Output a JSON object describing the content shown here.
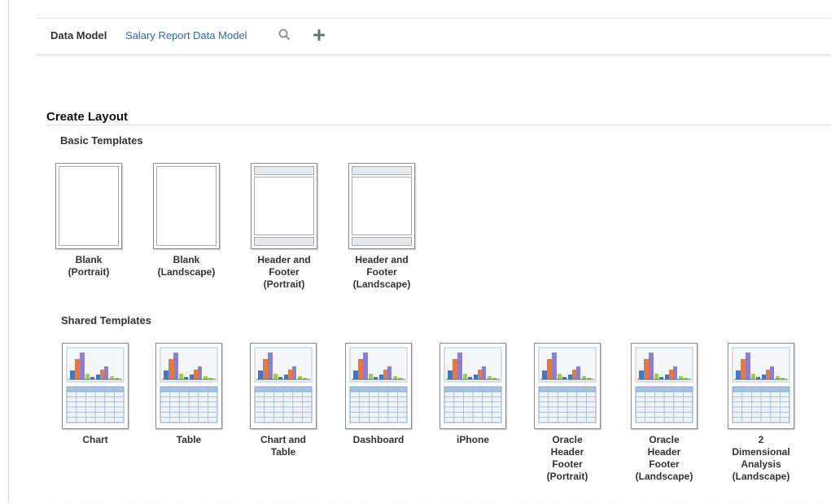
{
  "header": {
    "label": "Data Model",
    "data_model_link": "Salary Report Data Model",
    "search_icon": "search-icon",
    "add_icon": "plus-icon"
  },
  "create_layout": {
    "title": "Create Layout",
    "basic": {
      "title": "Basic Templates",
      "items": [
        {
          "lines": [
            "Blank",
            "(Portrait)"
          ],
          "kind": "blank"
        },
        {
          "lines": [
            "Blank",
            "(Landscape)"
          ],
          "kind": "blank"
        },
        {
          "lines": [
            "Header and",
            "Footer",
            "(Portrait)"
          ],
          "kind": "header-footer"
        },
        {
          "lines": [
            "Header and",
            "Footer",
            "(Landscape)"
          ],
          "kind": "header-footer"
        }
      ]
    },
    "shared": {
      "title": "Shared Templates",
      "items": [
        {
          "lines": [
            "Chart"
          ]
        },
        {
          "lines": [
            "Table"
          ]
        },
        {
          "lines": [
            "Chart and",
            "Table"
          ]
        },
        {
          "lines": [
            "Dashboard"
          ]
        },
        {
          "lines": [
            "iPhone"
          ]
        },
        {
          "lines": [
            "Oracle",
            "Header",
            "Footer",
            "(Portrait)"
          ]
        },
        {
          "lines": [
            "Oracle",
            "Header",
            "Footer",
            "(Landscape)"
          ]
        },
        {
          "lines": [
            "2",
            "Dimensional",
            "Analysis",
            "(Landscape)"
          ]
        }
      ]
    }
  },
  "colors": {
    "link": "#2e6da4",
    "bar_orange": "#e8783b",
    "bar_purple": "#8b7fd2",
    "bar_blue": "#3c78c8",
    "bar_green": "#9bd23a",
    "table_header": "#a9c3e3"
  }
}
